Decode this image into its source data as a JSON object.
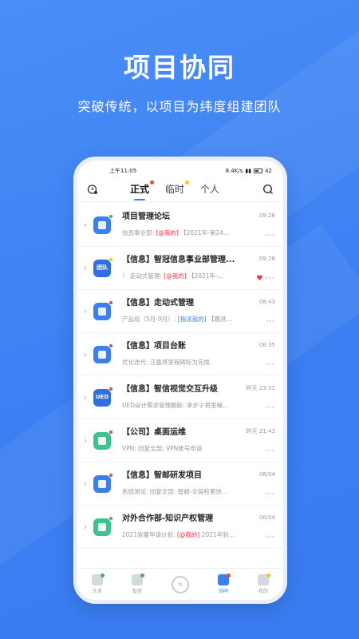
{
  "hero": {
    "title": "项目协同",
    "subtitle": "突破传统，以项目为纬度组建团队"
  },
  "status_bar": {
    "time": "上午11:05",
    "net_speed": "8.4K/s",
    "battery": "42"
  },
  "tabs": [
    {
      "label": "正式",
      "active": true,
      "dot_color": "#e8453c"
    },
    {
      "label": "临时",
      "active": false,
      "dot_color": "#f5c518"
    },
    {
      "label": "个人",
      "active": false,
      "dot_color": ""
    }
  ],
  "icons": {
    "left": "settings-clock-icon",
    "right": "search-icon"
  },
  "conversations": [
    {
      "title": "项目管理论坛",
      "time": "09:26",
      "pre": "信息事业部: ",
      "tag": "[@我的]",
      "tag_type": "mention",
      "post": " 【2021年-第24...",
      "avatar_color": "#3b7ff3",
      "avatar_text": "",
      "dot_color": "#4caf50",
      "heart": false
    },
    {
      "title": "【信息】智冠信息事业部管理...",
      "time": "09:26",
      "pre": "！ 走动式管理: ",
      "tag": "[@我的]",
      "tag_type": "mention",
      "post": " 【2021年-...",
      "avatar_color": "#2f6fe0",
      "avatar_text": "团队",
      "dot_color": "#f5c518",
      "heart": true
    },
    {
      "title": "【信息】走动式管理",
      "time": "08:43",
      "pre": "产品组（5月-9月）: ",
      "tag": "[指派我的]",
      "tag_type": "assign",
      "post": " 【跟进...",
      "avatar_color": "#3b7ff3",
      "avatar_text": "",
      "dot_color": "#e8453c",
      "heart": false
    },
    {
      "title": "【信息】项目台账",
      "time": "08:35",
      "pre": "优化迭代: 汪鑫将里程碑标为完成",
      "tag": "",
      "tag_type": "",
      "post": "",
      "avatar_color": "#3b7ff3",
      "avatar_text": "",
      "dot_color": "#e8453c",
      "heart": false
    },
    {
      "title": "【信息】智信视觉交互升级",
      "time": "昨天 23:51",
      "pre": "UED设计需求管理跟踪: 李步宁将里程...",
      "tag": "",
      "tag_type": "",
      "post": "",
      "avatar_color": "#2f6fe0",
      "avatar_text": "UED",
      "dot_color": "#e8453c",
      "heart": false
    },
    {
      "title": "【公司】桌面运维",
      "time": "昨天 21:43",
      "pre": "VPN: 回复全部: VPN账号申请",
      "tag": "",
      "tag_type": "",
      "post": "",
      "avatar_color": "#3ec28f",
      "avatar_text": "",
      "dot_color": "#e8453c",
      "heart": false
    },
    {
      "title": "【信息】智邮研发项目",
      "time": "06/04",
      "pre": "系统测试: 回复全部: 智邮-全局检索快...",
      "tag": "",
      "tag_type": "",
      "post": "",
      "avatar_color": "#3b7ff3",
      "avatar_text": "",
      "dot_color": "#e8453c",
      "heart": false
    },
    {
      "title": "对外合作部-知识产权管理",
      "time": "06/04",
      "pre": "2021软著申请计划: ",
      "tag": "[@我的]",
      "tag_type": "mention",
      "post": " 2021年软...",
      "avatar_color": "#3ec28f",
      "avatar_text": "",
      "dot_color": "#4caf50",
      "heart": false
    }
  ],
  "bottom_nav": [
    {
      "label": "头条",
      "active": false,
      "dot_color": "#4caf50"
    },
    {
      "label": "智信",
      "active": false,
      "dot_color": "#4caf50"
    },
    {
      "label": "",
      "active": false,
      "dot_color": "",
      "center": true
    },
    {
      "label": "协同",
      "active": true,
      "dot_color": "#e8453c"
    },
    {
      "label": "我的",
      "active": false,
      "dot_color": "#f5c518"
    }
  ]
}
